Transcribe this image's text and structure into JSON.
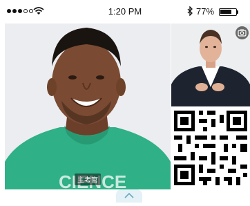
{
  "status_bar": {
    "time": "1:20 PM",
    "battery_percent": "77%",
    "battery_level": 0.77,
    "signal_bars_filled": 3,
    "signal_bars_total": 5,
    "icons": [
      "signal-dots-icon",
      "wifi-icon",
      "bluetooth-icon",
      "battery-icon"
    ]
  },
  "main_video": {
    "participant_label": "主考官"
  },
  "pip_video": {
    "camera_button_icon": "camera-icon"
  },
  "qr_panel": {
    "icon": "qr-code-icon"
  },
  "bottom_toggle": {
    "icon": "chevron-up-icon"
  },
  "colors": {
    "accent_tab": "#e4f1f6",
    "shirt_green": "#2fb086",
    "suit_dark": "#1d2430"
  }
}
